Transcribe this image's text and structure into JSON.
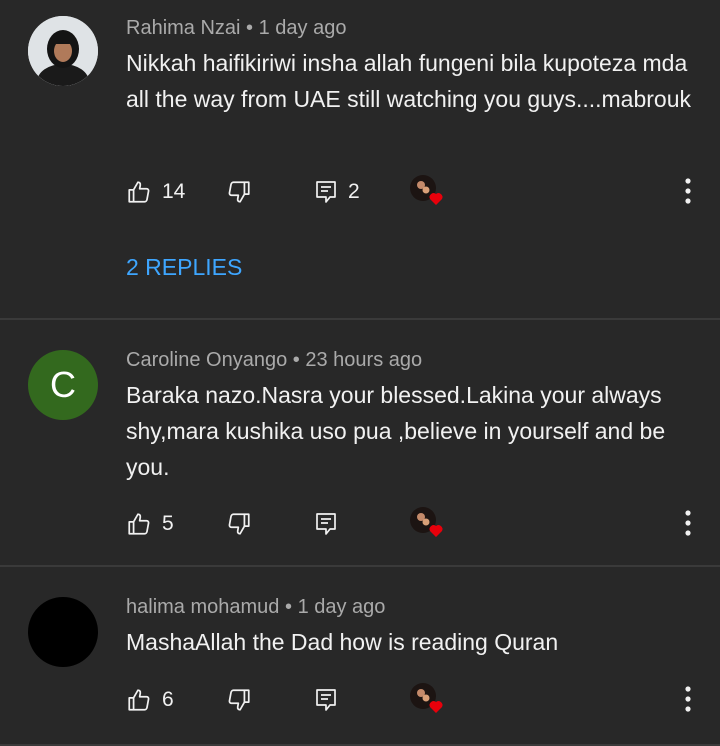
{
  "comments": [
    {
      "author": "Rahima Nzai",
      "time": "1 day ago",
      "text": "Nikkah haifikiriwi insha allah fungeni bila kupoteza mda all the way from UAE still watching you guys....mabrouk",
      "likes": "14",
      "replies_count": "2",
      "replies_label": "2 REPLIES",
      "avatar_type": "photo"
    },
    {
      "author": "Caroline Onyango",
      "time": "23 hours ago",
      "text": "Baraka nazo.Nasra your blessed.Lakina your always shy,mara kushika uso pua ,believe in yourself and be you.",
      "likes": "5",
      "avatar_letter": "C",
      "avatar_color": "#33691e"
    },
    {
      "author": "halima mohamud",
      "time": "1 day ago",
      "text": "MashaAllah the Dad how is reading Quran",
      "likes": "6",
      "avatar_color": "#000000"
    }
  ],
  "separator": "•",
  "colors": {
    "background": "#282828",
    "text": "#f1f1f1",
    "meta": "#aaaaaa",
    "link": "#3ea6ff",
    "heart": "#e8000b"
  },
  "icons": [
    "thumbs-up-icon",
    "thumbs-down-icon",
    "reply-icon",
    "creator-heart-icon",
    "more-vert-icon"
  ]
}
